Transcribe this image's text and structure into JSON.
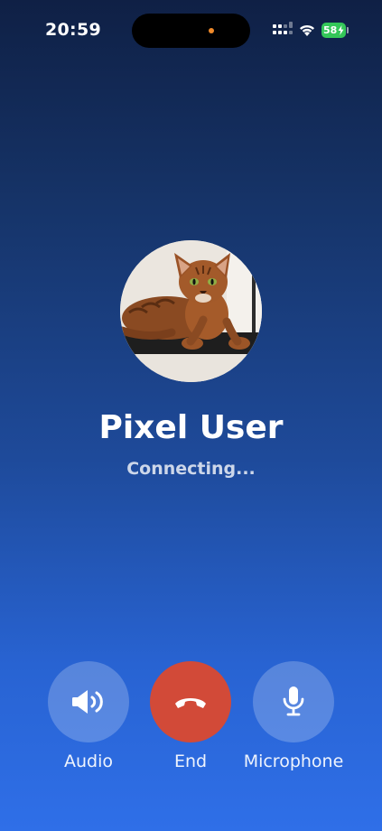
{
  "status_bar": {
    "time": "20:59",
    "battery_level": "58",
    "icons": [
      "cellular-signal-icon",
      "wifi-icon",
      "battery-charging-icon"
    ]
  },
  "call": {
    "contact_name": "Pixel User",
    "status": "Connecting...",
    "avatar": "cat-avatar-image"
  },
  "controls": {
    "audio_label": "Audio",
    "end_label": "End",
    "microphone_label": "Microphone",
    "audio_icon": "speaker-icon",
    "end_icon": "hang-up-icon",
    "microphone_icon": "microphone-icon"
  },
  "colors": {
    "end_button": "#d24a38",
    "battery": "#34c759",
    "island_indicator": "#f08a2a",
    "background_top": "#0f2045",
    "background_bottom": "#2f6fe8"
  }
}
